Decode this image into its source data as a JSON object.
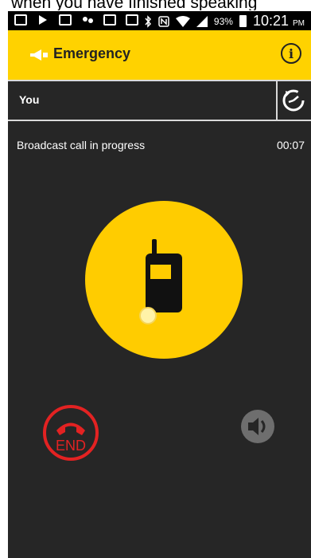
{
  "caption": {
    "text": "when you have finished speaking"
  },
  "statusbar": {
    "icons_left": [
      "message-icon",
      "play-icon",
      "gallery-icon",
      "dots-icon",
      "calendar-icon",
      "image-icon"
    ],
    "battery_percent": "93%",
    "time": "10:21",
    "ampm": "PM"
  },
  "appbar": {
    "title": "Emergency",
    "info_label": "i",
    "accent_color": "#ffd200"
  },
  "talker": {
    "name": "You"
  },
  "call": {
    "status": "Broadcast call in progress",
    "timer": "00:07"
  },
  "controls": {
    "end_label": "END",
    "end_color": "#e32222"
  }
}
